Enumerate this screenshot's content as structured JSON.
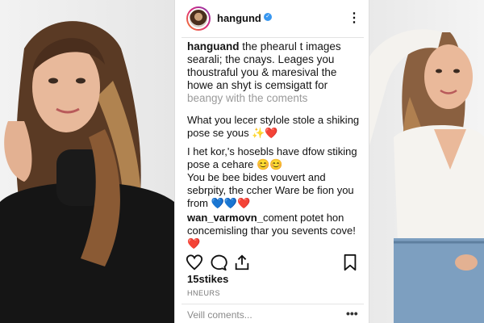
{
  "post": {
    "username": "hangund",
    "verified_icon": "verified-badge-icon",
    "more_icon": "more-vertical-icon",
    "caption_username": "hanguand",
    "caption_text": "the phearul t images searali; the cnays. Leages you thoustraful you & maresival the howe an shyt is cemsigatt for",
    "caption_faded": "beangy with the coments"
  },
  "comments": [
    {
      "text": "What you lecer stylole stole a shiking pose se yous ✨❤️"
    },
    {
      "text": "I het kor,'s hosebls have dfow stiking pose a cehare 😊😊"
    },
    {
      "text": "You be bee bides vouvert and sebrpity, the ccher Ware be fion you from 💙💙❤️"
    },
    {
      "username": "wan_varmovn_",
      "text": "coment potet hon concemisling thar you sevents cove! ❤️"
    }
  ],
  "actions": {
    "like_icon": "heart-icon",
    "comment_icon": "comment-icon",
    "share_icon": "share-icon",
    "save_icon": "bookmark-icon"
  },
  "likes_text": "15stikes",
  "meta_text": "HNEURS",
  "view_comments": "Veill coments...",
  "more_bottom": "•••"
}
